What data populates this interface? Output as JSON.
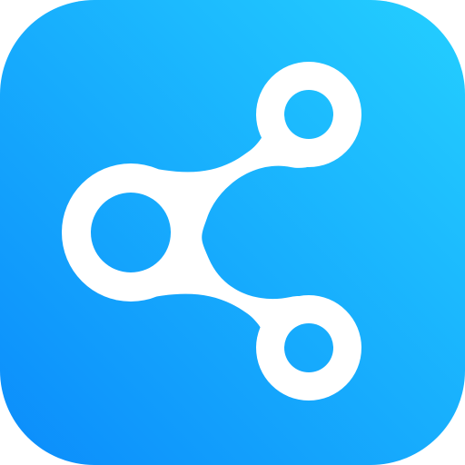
{
  "app_icon": {
    "icon_name": "share-icon",
    "colors": {
      "gradient_top_right": "#24CFFF",
      "gradient_bottom_left": "#0B8CFB",
      "glyph": "#FFFFFF"
    }
  }
}
